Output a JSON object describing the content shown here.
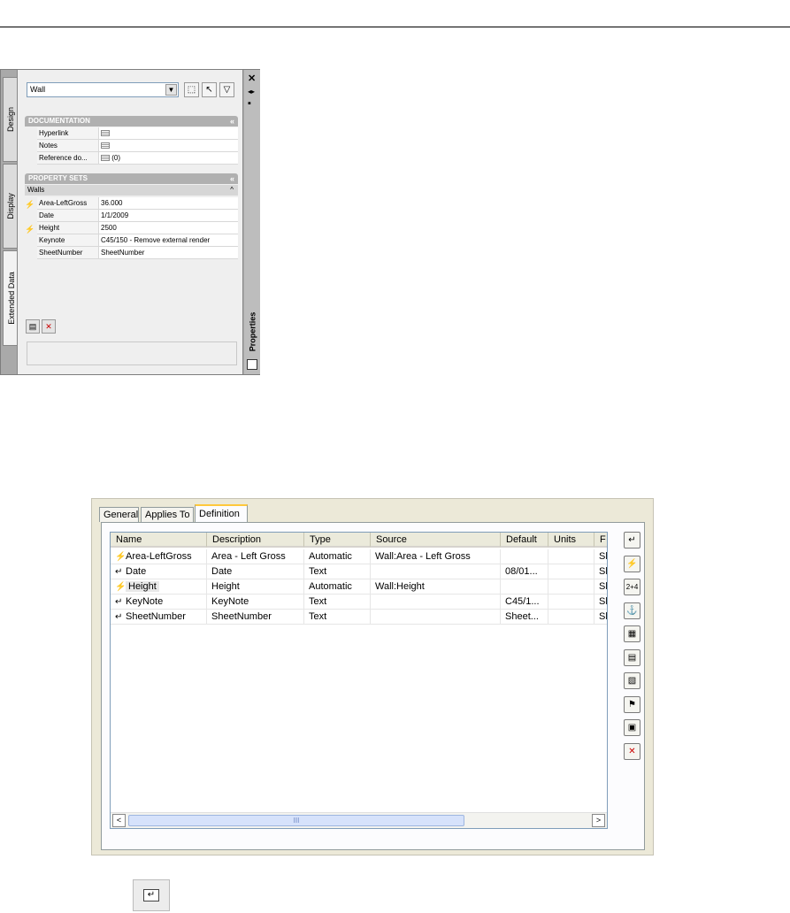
{
  "palette": {
    "tabs": [
      "Design",
      "Display",
      "Extended Data"
    ],
    "right_tab": "Properties",
    "right_controls": {
      "close": "✕",
      "autohide": "◂▸",
      "menu": "▪"
    },
    "style_combo": "Wall",
    "sections": {
      "documentation": {
        "title": "DOCUMENTATION",
        "rows": [
          {
            "name": "Hyperlink",
            "value": ""
          },
          {
            "name": "Notes",
            "value": ""
          },
          {
            "name": "Reference do...",
            "value": "(0)"
          }
        ]
      },
      "property_sets": {
        "title": "PROPERTY SETS",
        "subheader": "Walls",
        "rows": [
          {
            "name": "Area-LeftGross",
            "value": "36.000",
            "auto": true
          },
          {
            "name": "Date",
            "value": "1/1/2009",
            "auto": false
          },
          {
            "name": "Height",
            "value": "2500",
            "auto": true
          },
          {
            "name": "Keynote",
            "value": "C45/150 - Remove external render",
            "auto": false
          },
          {
            "name": "SheetNumber",
            "value": "SheetNumber",
            "auto": false
          }
        ]
      }
    }
  },
  "dialog": {
    "tabs": [
      "General",
      "Applies To",
      "Definition"
    ],
    "active_tab": "Definition",
    "columns": [
      "Name",
      "Description",
      "Type",
      "Source",
      "Default",
      "Units",
      "F"
    ],
    "rows": [
      {
        "name": "Area-LeftGross",
        "description": "Area - Left Gross",
        "type": "Automatic",
        "source": "Wall:Area - Left Gross",
        "default": "",
        "units": "",
        "f": "Sl",
        "auto": true
      },
      {
        "name": "Date",
        "description": "Date",
        "type": "Text",
        "source": "",
        "default": "08/01...",
        "units": "",
        "f": "Sl",
        "auto": false
      },
      {
        "name": "Height",
        "description": "Height",
        "type": "Automatic",
        "source": "Wall:Height",
        "default": "",
        "units": "",
        "f": "Sl",
        "auto": true
      },
      {
        "name": "KeyNote",
        "description": "KeyNote",
        "type": "Text",
        "source": "",
        "default": "C45/1...",
        "units": "",
        "f": "Sl",
        "auto": false
      },
      {
        "name": "SheetNumber",
        "description": "SheetNumber",
        "type": "Text",
        "source": "",
        "default": "Sheet...",
        "units": "",
        "f": "Sl",
        "auto": false
      }
    ],
    "scroll_grip": "III",
    "side_buttons": [
      {
        "name": "add-manual-property-button",
        "glyph": "↵"
      },
      {
        "name": "add-automatic-property-button",
        "glyph": "⚡"
      },
      {
        "name": "add-formula-property-button",
        "glyph": "2+4"
      },
      {
        "name": "add-anchor-property-button",
        "glyph": "⚓"
      },
      {
        "name": "add-location-property-button",
        "glyph": "▦"
      },
      {
        "name": "add-classification-property-button",
        "glyph": "▤"
      },
      {
        "name": "add-material-property-button",
        "glyph": "▧"
      },
      {
        "name": "add-project-property-button",
        "glyph": "⚑"
      },
      {
        "name": "add-graphic-property-button",
        "glyph": "▣"
      },
      {
        "name": "remove-property-button",
        "glyph": "✕"
      }
    ]
  },
  "footer_button_glyph": "↵",
  "colors": {
    "auto_icon": "#b89a00",
    "remove": "#cc0000",
    "active_tab_accent": "#ffc83c"
  }
}
